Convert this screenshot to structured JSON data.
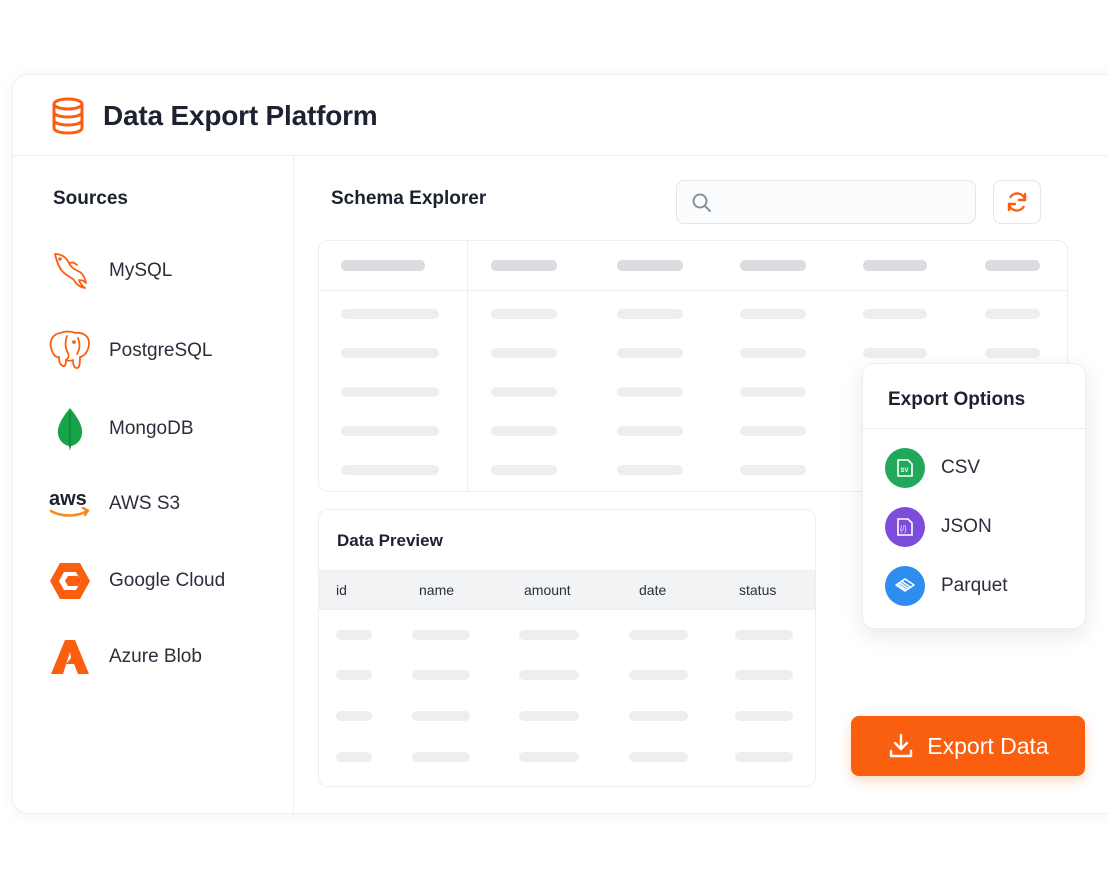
{
  "app": {
    "title": "Data Export Platform",
    "icon": "database-icon",
    "accent_color": "#fa5f10"
  },
  "sidebar": {
    "title": "Sources",
    "items": [
      {
        "label": "MySQL",
        "icon": "mysql-dolphin-icon"
      },
      {
        "label": "PostgreSQL",
        "icon": "postgresql-elephant-icon"
      },
      {
        "label": "MongoDB",
        "icon": "mongodb-leaf-icon"
      },
      {
        "label": "AWS S3",
        "icon": "aws-logo-icon"
      },
      {
        "label": "Google Cloud",
        "icon": "google-cloud-icon"
      },
      {
        "label": "Azure Blob",
        "icon": "azure-icon"
      }
    ]
  },
  "schema": {
    "title": "Schema Explorer",
    "search": {
      "placeholder": "",
      "value": "",
      "icon": "search-icon"
    },
    "refresh_icon": "refresh-icon"
  },
  "preview": {
    "title": "Data Preview",
    "columns": [
      "id",
      "name",
      "amount",
      "date",
      "status"
    ]
  },
  "export_options": {
    "title": "Export Options",
    "options": [
      {
        "label": "CSV",
        "icon": "csv-file-icon",
        "color": "#21a85a"
      },
      {
        "label": "JSON",
        "icon": "json-file-icon",
        "color": "#7c4ddb"
      },
      {
        "label": "Parquet",
        "icon": "parquet-icon",
        "color": "#2d8ef0"
      }
    ]
  },
  "export_button": {
    "label": "Export Data",
    "icon": "download-icon"
  }
}
